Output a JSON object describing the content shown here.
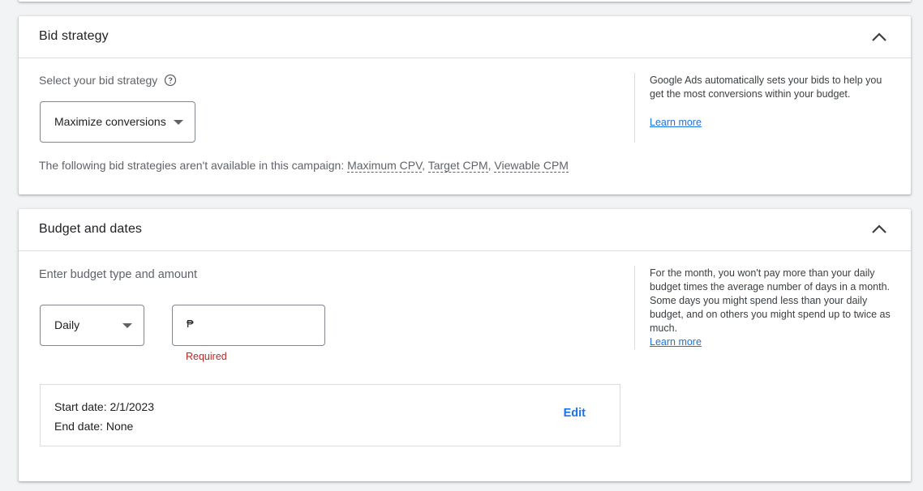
{
  "bid_strategy": {
    "title": "Bid strategy",
    "select_label": "Select your bid strategy",
    "selected_strategy": "Maximize conversions",
    "unavailable_prefix": "The following bid strategies aren't available in this campaign: ",
    "unavailable_items": [
      "Maximum CPV",
      "Target CPM",
      "Viewable CPM"
    ],
    "separator": ", ",
    "side_text": "Google Ads automatically sets your bids to help you get the most conversions within your budget.",
    "learn_more": "Learn more"
  },
  "budget": {
    "title": "Budget and dates",
    "enter_label": "Enter budget type and amount",
    "budget_type": "Daily",
    "currency_symbol": "₱",
    "amount_value": "",
    "required_text": "Required",
    "start_date": "Start date: 2/1/2023",
    "end_date": "End date: None",
    "edit_label": "Edit",
    "side_text": "For the month, you won't pay more than your daily budget times the average number of days in a month. Some days you might spend less than your daily budget, and on others you might spend up to twice as much.",
    "learn_more": "Learn more"
  },
  "icons": {
    "collapse": "chevron-up-icon",
    "help": "help-circle-icon",
    "dropdown": "caret-down-icon"
  },
  "colors": {
    "link": "#1a73e8",
    "error": "#c5221f",
    "background": "#f1f3f4"
  }
}
